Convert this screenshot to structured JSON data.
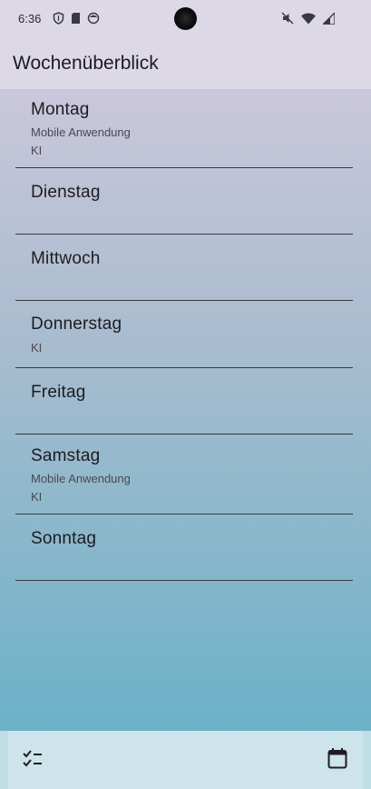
{
  "status_bar": {
    "time": "6:36",
    "left_icons": [
      "shield-icon",
      "sd-card-icon",
      "face-icon"
    ],
    "right_icons": [
      "mute-icon",
      "wifi-icon",
      "signal-icon"
    ]
  },
  "app_bar": {
    "title": "Wochenüberblick"
  },
  "days": [
    {
      "name": "Montag",
      "entries": [
        "Mobile Anwendung",
        "KI"
      ]
    },
    {
      "name": "Dienstag",
      "entries": []
    },
    {
      "name": "Mittwoch",
      "entries": []
    },
    {
      "name": "Donnerstag",
      "entries": [
        "KI"
      ]
    },
    {
      "name": "Freitag",
      "entries": []
    },
    {
      "name": "Samstag",
      "entries": [
        "Mobile Anwendung",
        "KI"
      ]
    },
    {
      "name": "Sonntag",
      "entries": []
    }
  ],
  "bottom_nav": {
    "left_icon": "checklist-icon",
    "right_icon": "calendar-icon"
  },
  "colors": {
    "app_bar_bg": "#ddd8e6",
    "gradient_top": "#cac7db",
    "gradient_bottom": "#6cb1c7",
    "bottom_bar_bg": "#cde4ea",
    "divider": "#3a3a3e"
  }
}
